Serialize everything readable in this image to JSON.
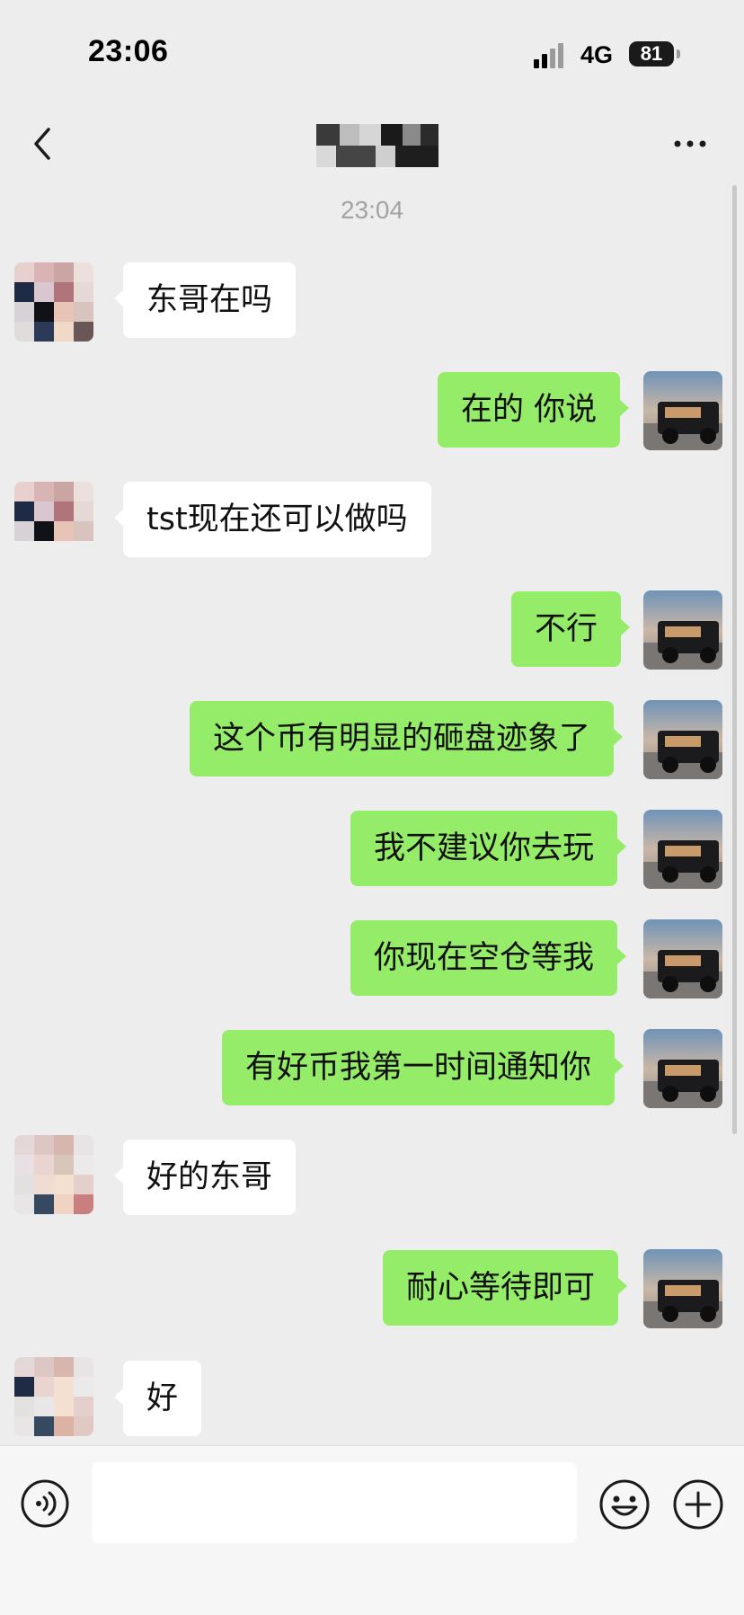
{
  "status_bar": {
    "time": "23:06",
    "network": "4G",
    "battery": "81"
  },
  "nav": {
    "back_icon": "chevron-left-icon",
    "more_icon": "ellipsis-icon"
  },
  "chat": {
    "timestamp": "23:04",
    "messages": [
      {
        "from": "contact",
        "text": "东哥在吗"
      },
      {
        "from": "me",
        "text": "在的 你说"
      },
      {
        "from": "contact",
        "text": "tst现在还可以做吗"
      },
      {
        "from": "me",
        "text": "不行"
      },
      {
        "from": "me",
        "text": "这个币有明显的砸盘迹象了"
      },
      {
        "from": "me",
        "text": "我不建议你去玩"
      },
      {
        "from": "me",
        "text": "你现在空仓等我"
      },
      {
        "from": "me",
        "text": "有好币我第一时间通知你"
      },
      {
        "from": "contact",
        "text": "好的东哥"
      },
      {
        "from": "me",
        "text": "耐心等待即可"
      },
      {
        "from": "contact",
        "text": "好"
      }
    ]
  },
  "input_bar": {
    "voice_icon": "voice-icon",
    "emoji_icon": "emoji-icon",
    "plus_icon": "plus-icon",
    "text_value": ""
  },
  "colors": {
    "background": "#ededed",
    "outgoing_bubble": "#95ec69",
    "incoming_bubble": "#ffffff",
    "timestamp": "#a3a3a3"
  }
}
